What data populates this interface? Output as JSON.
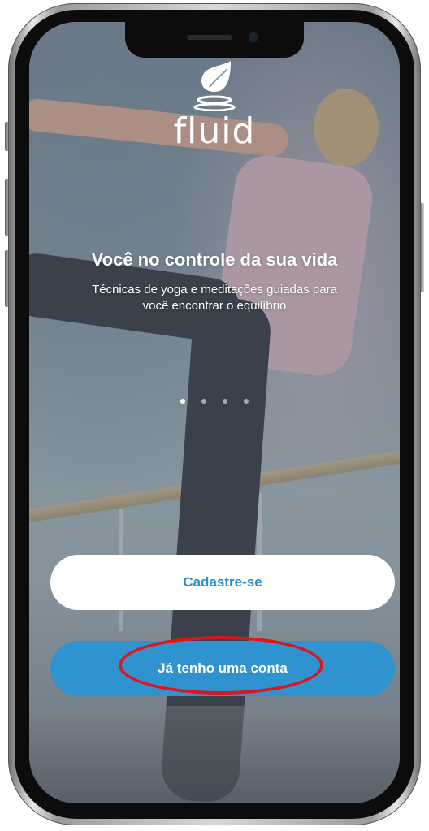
{
  "app": {
    "logo_text": "fluid",
    "logo_icon": "leaf-icon"
  },
  "onboarding": {
    "headline": "Você no controle da sua vida",
    "subtitle": "Técnicas de yoga e meditações guiadas para você encontrar o equilíbrio",
    "pager": {
      "total": 4,
      "active_index": 0
    }
  },
  "actions": {
    "register_label": "Cadastre-se",
    "login_label": "Já tenho uma conta"
  },
  "colors": {
    "accent": "#2e93cf",
    "register_text": "#2a8fcb",
    "highlight": "#e0141b"
  }
}
